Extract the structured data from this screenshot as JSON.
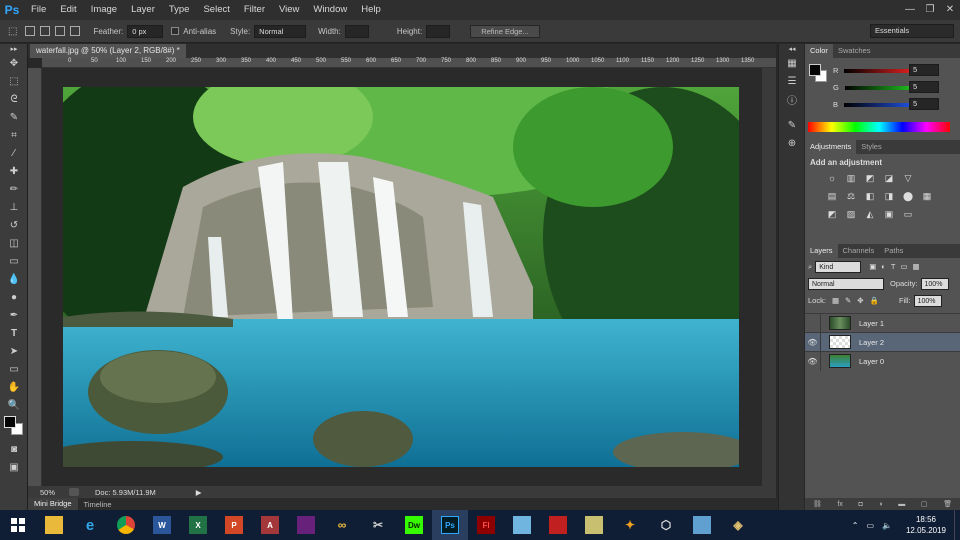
{
  "app": {
    "logo": "Ps",
    "menu": [
      "File",
      "Edit",
      "Image",
      "Layer",
      "Type",
      "Select",
      "Filter",
      "View",
      "Window",
      "Help"
    ],
    "window_controls": [
      "—",
      "❐",
      "✕"
    ]
  },
  "options_bar": {
    "feather_label": "Feather:",
    "feather_value": "0 px",
    "antialias_label": "Anti-alias",
    "style_label": "Style:",
    "style_value": "Normal",
    "width_label": "Width:",
    "height_label": "Height:",
    "refine_edge": "Refine Edge...",
    "workspace": "Essentials"
  },
  "document": {
    "tab_title": "waterfall.jpg @ 50% (Layer 2, RGB/8#) *",
    "ruler_marks": [
      "0",
      "50",
      "100",
      "150",
      "200",
      "250",
      "300",
      "350",
      "400",
      "450",
      "500",
      "550",
      "600",
      "650",
      "700",
      "750",
      "800",
      "850",
      "900",
      "950",
      "1000",
      "1050",
      "1100",
      "1150",
      "1200",
      "1250",
      "1300",
      "1350"
    ],
    "zoom": "50%",
    "doc_size": "Doc: 5.93M/11.9M"
  },
  "bottom_tabs": [
    "Mini Bridge",
    "Timeline"
  ],
  "color_panel": {
    "tabs": [
      "Color",
      "Swatches"
    ],
    "channels": [
      {
        "label": "R",
        "value": "5",
        "color": "#e02020"
      },
      {
        "label": "G",
        "value": "5",
        "color": "#20c020"
      },
      {
        "label": "B",
        "value": "5",
        "color": "#2050e0"
      }
    ]
  },
  "adjustments_panel": {
    "tabs": [
      "Adjustments",
      "Styles"
    ],
    "title": "Add an adjustment"
  },
  "layers_panel": {
    "tabs": [
      "Layers",
      "Channels",
      "Paths"
    ],
    "kind_label": "Kind",
    "blend_mode": "Normal",
    "opacity_label": "Opacity:",
    "opacity_value": "100%",
    "lock_label": "Lock:",
    "fill_label": "Fill:",
    "fill_value": "100%",
    "layers": [
      {
        "name": "Layer 1",
        "visible": false,
        "selected": false
      },
      {
        "name": "Layer 2",
        "visible": true,
        "selected": true
      },
      {
        "name": "Layer 0",
        "visible": true,
        "selected": false
      }
    ]
  },
  "taskbar": {
    "time": "18:56",
    "date": "12.05.2019",
    "apps": [
      {
        "icon": "windows-start-icon",
        "label": ""
      },
      {
        "icon": "file-explorer-icon",
        "label": ""
      },
      {
        "icon": "internet-explorer-icon",
        "label": "e"
      },
      {
        "icon": "chrome-icon",
        "label": ""
      },
      {
        "icon": "word-icon",
        "label": "W"
      },
      {
        "icon": "excel-icon",
        "label": "X"
      },
      {
        "icon": "powerpoint-icon",
        "label": "P"
      },
      {
        "icon": "access-icon",
        "label": "A"
      },
      {
        "icon": "visual-studio-icon",
        "label": ""
      },
      {
        "icon": "app-icon",
        "label": ""
      },
      {
        "icon": "tools-icon",
        "label": ""
      },
      {
        "icon": "dreamweaver-icon",
        "label": "Dw"
      },
      {
        "icon": "photoshop-icon",
        "label": "Ps"
      },
      {
        "icon": "flash-icon",
        "label": "Fl"
      },
      {
        "icon": "app-icon",
        "label": ""
      },
      {
        "icon": "app-icon",
        "label": ""
      },
      {
        "icon": "app-icon",
        "label": ""
      },
      {
        "icon": "app-icon",
        "label": ""
      },
      {
        "icon": "3d-icon",
        "label": ""
      },
      {
        "icon": "app-icon",
        "label": ""
      },
      {
        "icon": "app-icon",
        "label": ""
      }
    ]
  }
}
